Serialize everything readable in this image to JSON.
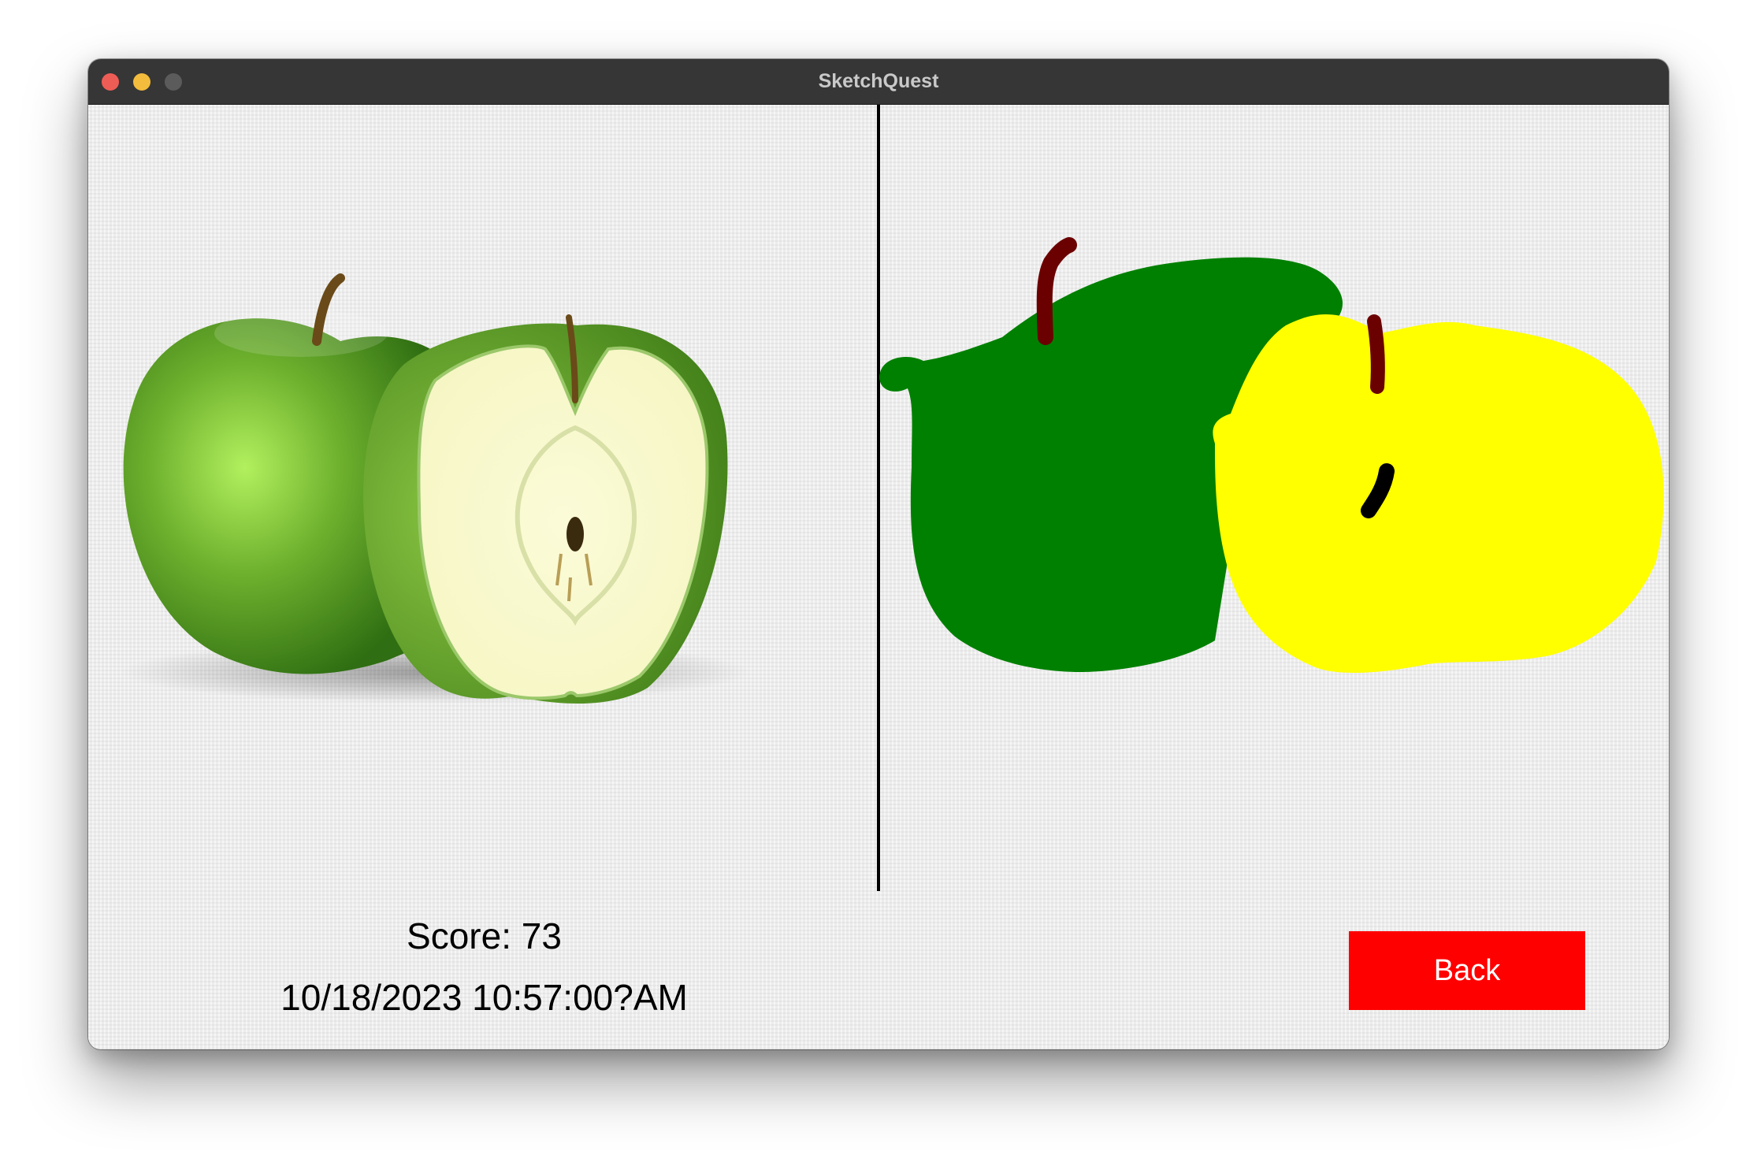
{
  "window": {
    "title": "SketchQuest"
  },
  "result": {
    "score_text": "Score: 73",
    "timestamp_text": "10/18/2023 10:57:00?AM"
  },
  "actions": {
    "back_label": "Back"
  },
  "colors": {
    "titlebar": "#363636",
    "back_button": "#ff0000",
    "drawing_green": "#008000",
    "drawing_yellow": "#ffff00",
    "drawing_stem": "#6b0000"
  }
}
